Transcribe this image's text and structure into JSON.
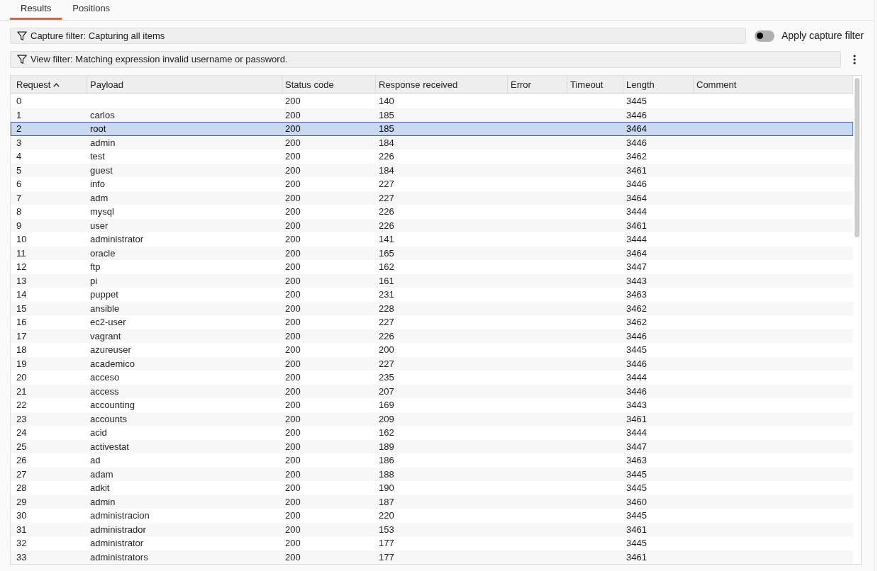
{
  "tabs": [
    {
      "label": "Results",
      "selected": true
    },
    {
      "label": "Positions",
      "selected": false
    }
  ],
  "capture_filter": {
    "text": "Capture filter: Capturing all items"
  },
  "apply_capture_filter": {
    "label": "Apply capture filter",
    "on": false
  },
  "view_filter": {
    "text": "View filter: Matching expression invalid username or password."
  },
  "table": {
    "columns": [
      {
        "label": "Request",
        "sorted": true
      },
      {
        "label": "Payload",
        "sorted": false
      },
      {
        "label": "Status code",
        "sorted": false
      },
      {
        "label": "Response received",
        "sorted": false
      },
      {
        "label": "Error",
        "sorted": false
      },
      {
        "label": "Timeout",
        "sorted": false
      },
      {
        "label": "Length",
        "sorted": false
      },
      {
        "label": "Comment",
        "sorted": false
      }
    ],
    "rows": [
      {
        "request": "0",
        "status_code": "200",
        "response_received": "140",
        "length": "3445",
        "selected": false
      },
      {
        "request": "1",
        "payload": "carlos",
        "status_code": "200",
        "response_received": "185",
        "length": "3446",
        "selected": false
      },
      {
        "request": "2",
        "payload": "root",
        "status_code": "200",
        "response_received": "185",
        "length": "3464",
        "selected": true
      },
      {
        "request": "3",
        "payload": "admin",
        "status_code": "200",
        "response_received": "184",
        "length": "3446",
        "selected": false
      },
      {
        "request": "4",
        "payload": "test",
        "status_code": "200",
        "response_received": "226",
        "length": "3462",
        "selected": false
      },
      {
        "request": "5",
        "payload": "guest",
        "status_code": "200",
        "response_received": "184",
        "length": "3461",
        "selected": false
      },
      {
        "request": "6",
        "payload": "info",
        "status_code": "200",
        "response_received": "227",
        "length": "3446",
        "selected": false
      },
      {
        "request": "7",
        "payload": "adm",
        "status_code": "200",
        "response_received": "227",
        "length": "3464",
        "selected": false
      },
      {
        "request": "8",
        "payload": "mysql",
        "status_code": "200",
        "response_received": "226",
        "length": "3444",
        "selected": false
      },
      {
        "request": "9",
        "payload": "user",
        "status_code": "200",
        "response_received": "226",
        "length": "3461",
        "selected": false
      },
      {
        "request": "10",
        "payload": "administrator",
        "status_code": "200",
        "response_received": "141",
        "length": "3444",
        "selected": false
      },
      {
        "request": "11",
        "payload": "oracle",
        "status_code": "200",
        "response_received": "165",
        "length": "3464",
        "selected": false
      },
      {
        "request": "12",
        "payload": "ftp",
        "status_code": "200",
        "response_received": "162",
        "length": "3447",
        "selected": false
      },
      {
        "request": "13",
        "payload": "pi",
        "status_code": "200",
        "response_received": "161",
        "length": "3443",
        "selected": false
      },
      {
        "request": "14",
        "payload": "puppet",
        "status_code": "200",
        "response_received": "231",
        "length": "3463",
        "selected": false
      },
      {
        "request": "15",
        "payload": "ansible",
        "status_code": "200",
        "response_received": "228",
        "length": "3462",
        "selected": false
      },
      {
        "request": "16",
        "payload": "ec2-user",
        "status_code": "200",
        "response_received": "227",
        "length": "3462",
        "selected": false
      },
      {
        "request": "17",
        "payload": "vagrant",
        "status_code": "200",
        "response_received": "226",
        "length": "3446",
        "selected": false
      },
      {
        "request": "18",
        "payload": "azureuser",
        "status_code": "200",
        "response_received": "200",
        "length": "3445",
        "selected": false
      },
      {
        "request": "19",
        "payload": "academico",
        "status_code": "200",
        "response_received": "227",
        "length": "3446",
        "selected": false
      },
      {
        "request": "20",
        "payload": "acceso",
        "status_code": "200",
        "response_received": "235",
        "length": "3444",
        "selected": false
      },
      {
        "request": "21",
        "payload": "access",
        "status_code": "200",
        "response_received": "207",
        "length": "3446",
        "selected": false
      },
      {
        "request": "22",
        "payload": "accounting",
        "status_code": "200",
        "response_received": "169",
        "length": "3443",
        "selected": false
      },
      {
        "request": "23",
        "payload": "accounts",
        "status_code": "200",
        "response_received": "209",
        "length": "3461",
        "selected": false
      },
      {
        "request": "24",
        "payload": "acid",
        "status_code": "200",
        "response_received": "162",
        "length": "3444",
        "selected": false
      },
      {
        "request": "25",
        "payload": "activestat",
        "status_code": "200",
        "response_received": "189",
        "length": "3447",
        "selected": false
      },
      {
        "request": "26",
        "payload": "ad",
        "status_code": "200",
        "response_received": "186",
        "length": "3463",
        "selected": false
      },
      {
        "request": "27",
        "payload": "adam",
        "status_code": "200",
        "response_received": "188",
        "length": "3445",
        "selected": false
      },
      {
        "request": "28",
        "payload": "adkit",
        "status_code": "200",
        "response_received": "190",
        "length": "3445",
        "selected": false
      },
      {
        "request": "29",
        "payload": "admin",
        "status_code": "200",
        "response_received": "187",
        "length": "3460",
        "selected": false
      },
      {
        "request": "30",
        "payload": "administracion",
        "status_code": "200",
        "response_received": "220",
        "length": "3445",
        "selected": false
      },
      {
        "request": "31",
        "payload": "administrador",
        "status_code": "200",
        "response_received": "153",
        "length": "3461",
        "selected": false
      },
      {
        "request": "32",
        "payload": "administrator",
        "status_code": "200",
        "response_received": "177",
        "length": "3445",
        "selected": false
      },
      {
        "request": "33",
        "payload": "administrators",
        "status_code": "200",
        "response_received": "177",
        "length": "3461",
        "selected": false
      }
    ]
  }
}
